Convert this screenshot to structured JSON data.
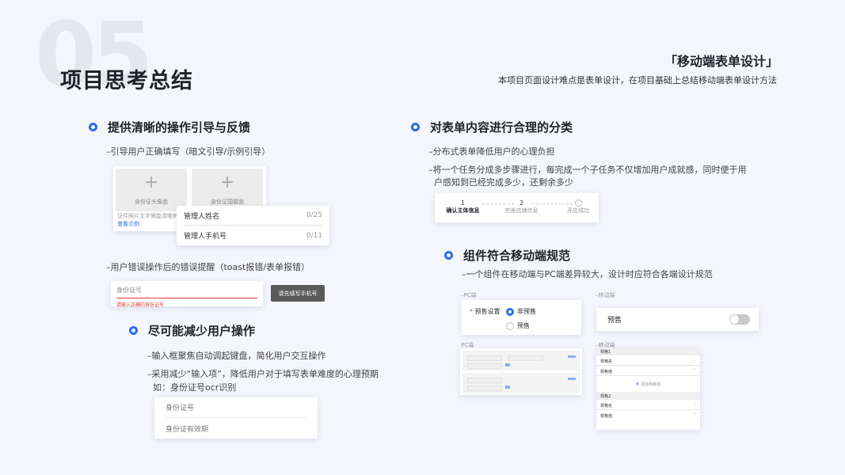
{
  "header": {
    "section_number": "05",
    "title": "项目思考总结",
    "brand_title": "「移动端表单设计」",
    "brand_subtitle": "本项目页面设计难点是表单设计，在项目基础上总结移动端表单设计方法"
  },
  "sec1": {
    "title": "提供清晰的操作引导与反馈",
    "note1": "–引导用户正确填写（暗文引导/示例引导）",
    "mock": {
      "upload_front": "身份证头像面",
      "upload_back": "身份证国徽面",
      "hint": "证件照片文字需能清晰辨认",
      "example_link": "查看示例",
      "field1_label": "管理人姓名",
      "field1_count": "0/25",
      "field2_label": "管理人手机号",
      "field2_count": "0/11"
    },
    "note2": "–用户错误操作后的错误提醒（toast报错/表单报错）",
    "error_mock": {
      "input_label": "身份证号",
      "error_text": "请输入正确的身份证号",
      "toast_text": "请先填写手机号"
    }
  },
  "sec2": {
    "title": "尽可能减少用户操作",
    "note1": "–输入框聚焦自动调起键盘，简化用户交互操作",
    "note2_line1": "–采用减少“输入项”，降低用户对于填写表单难度的心理预期",
    "note2_line2": "如：身份证号ocr识别",
    "mock": {
      "field1": "身份证号",
      "field2": "身份证有效期"
    }
  },
  "sec3": {
    "title": "对表单内容进行合理的分类",
    "note1": "–分布式表单降低用户的心理负担",
    "note2_line1": "–将一个任务分成多步骤进行，每完成一个子任务不仅增加用户成就感，同时便于用",
    "note2_line2": "户感知到已经完成多少，还剩余多少",
    "steps": [
      {
        "num": "1",
        "label": "确认主体信息"
      },
      {
        "num": "2",
        "label": "完善店铺信息"
      },
      {
        "num": "",
        "label": "开店成功"
      }
    ]
  },
  "sec4": {
    "title": "组件符合移动端规范",
    "note1": "–一个组件在移动端与PC端差异较大，设计时应符合各端设计规范",
    "pc_label": "–PC端",
    "mobile_label": "–移动端",
    "pc_radio": {
      "label": "预售设置",
      "option1": "非预售",
      "option2": "预售"
    },
    "mobile_toggle_label": "预售",
    "pc2_label": "PC端",
    "mobile2_label": "–移动端",
    "pc_spec_link": "添加规格",
    "mobile_spec": {
      "group1": "规格1",
      "row1": "规格名",
      "row2": "规格值",
      "add": "添加规格值",
      "group2": "规格2",
      "row3": "规格名",
      "row4": "规格值"
    }
  },
  "colors": {
    "accent": "#2a6ce8",
    "error": "#e83a3a",
    "background": "#f4f6fb"
  }
}
